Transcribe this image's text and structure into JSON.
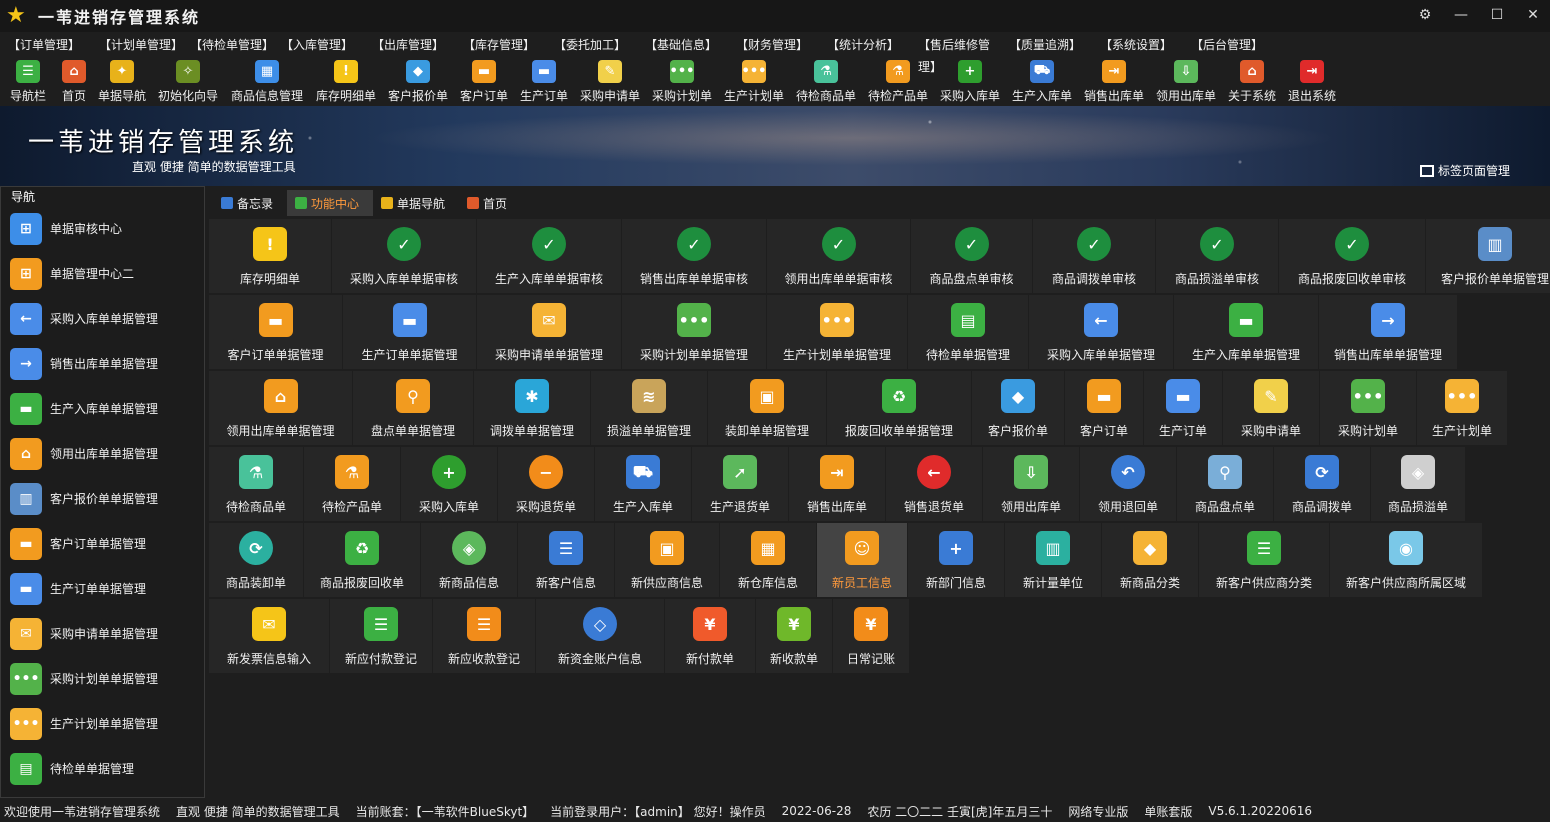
{
  "window": {
    "title": "一苇进销存管理系统"
  },
  "menu": [
    "【订单管理】",
    "【计划单管理】",
    "【待检单管理】",
    "【入库管理】",
    "【出库管理】",
    "【库存管理】",
    "【委托加工】",
    "【基础信息】",
    "【财务管理】",
    "【统计分析】",
    "【售后维修管理】",
    "【质量追溯】",
    "【系统设置】",
    "【后台管理】"
  ],
  "toolbar": [
    {
      "label": "导航栏",
      "icon": "menu-icon",
      "color": "#3cb043",
      "glyph": "☰",
      "w": 56
    },
    {
      "label": "首页",
      "icon": "home-icon",
      "color": "#e05a2b",
      "glyph": "⌂",
      "w": 36
    },
    {
      "label": "单据导航",
      "icon": "wand-icon",
      "color": "#e8b21a",
      "glyph": "✦",
      "w": 60
    },
    {
      "label": "初始化向导",
      "icon": "magic-icon",
      "color": "#6b8e23",
      "glyph": "✧",
      "w": 72
    },
    {
      "label": "商品信息管理",
      "icon": "cubes-icon",
      "color": "#3d8ee8",
      "glyph": "▦",
      "w": 86
    },
    {
      "label": "库存明细单",
      "icon": "warning-icon",
      "color": "#f5c518",
      "glyph": "!",
      "w": 72
    },
    {
      "label": "客户报价单",
      "icon": "tag-icon",
      "color": "#3a9be0",
      "glyph": "◆",
      "w": 72
    },
    {
      "label": "客户订单",
      "icon": "order-icon",
      "color": "#f29b1f",
      "glyph": "▬",
      "w": 60
    },
    {
      "label": "生产订单",
      "icon": "production-order-icon",
      "color": "#4a8ce8",
      "glyph": "▬",
      "w": 60
    },
    {
      "label": "采购申请单",
      "icon": "request-icon",
      "color": "#f1d04a",
      "glyph": "✎",
      "w": 72
    },
    {
      "label": "采购计划单",
      "icon": "chat-green-icon",
      "color": "#53b24a",
      "glyph": "•••",
      "w": 72
    },
    {
      "label": "生产计划单",
      "icon": "chat-orange-icon",
      "color": "#f5b335",
      "glyph": "•••",
      "w": 72
    },
    {
      "label": "待检商品单",
      "icon": "flask-green-icon",
      "color": "#49c29a",
      "glyph": "⚗",
      "w": 72
    },
    {
      "label": "待检产品单",
      "icon": "flask-orange-icon",
      "color": "#f29b1f",
      "glyph": "⚗",
      "w": 72
    },
    {
      "label": "采购入库单",
      "icon": "plus-icon",
      "color": "#2e9e2e",
      "glyph": "+",
      "w": 72
    },
    {
      "label": "生产入库单",
      "icon": "cart-icon",
      "color": "#3a7bd5",
      "glyph": "⛟",
      "w": 72
    },
    {
      "label": "销售出库单",
      "icon": "export-icon",
      "color": "#f29b1f",
      "glyph": "⇥",
      "w": 72
    },
    {
      "label": "领用出库单",
      "icon": "download-icon",
      "color": "#5cb85c",
      "glyph": "⇩",
      "w": 72
    },
    {
      "label": "关于系统",
      "icon": "about-icon",
      "color": "#e05a2b",
      "glyph": "⌂",
      "w": 60
    },
    {
      "label": "退出系统",
      "icon": "exit-icon",
      "color": "#e02b2b",
      "glyph": "⇥",
      "w": 60
    }
  ],
  "banner": {
    "title": "一苇进销存管理系统",
    "subtitle": "直观 便捷 简单的数据管理工具",
    "tab_manage": "标签页面管理"
  },
  "sidebar": {
    "title": "导航",
    "items": [
      {
        "label": "单据审核中心",
        "icon": "grid-blue-icon",
        "color": "#3d8ee8",
        "glyph": "⊞"
      },
      {
        "label": "单据管理中心二",
        "icon": "grid-orange-icon",
        "color": "#f29b1f",
        "glyph": "⊞"
      },
      {
        "label": "采购入库单单据管理",
        "icon": "arrow-left-icon",
        "color": "#4a8ce8",
        "glyph": "←"
      },
      {
        "label": "销售出库单单据管理",
        "icon": "arrow-right-icon",
        "color": "#4a8ce8",
        "glyph": "→"
      },
      {
        "label": "生产入库单单据管理",
        "icon": "box-green-icon",
        "color": "#3cb043",
        "glyph": "▬"
      },
      {
        "label": "领用出库单单据管理",
        "icon": "box-orange-icon",
        "color": "#f29b1f",
        "glyph": "⌂"
      },
      {
        "label": "客户报价单单据管理",
        "icon": "books-icon",
        "color": "#5a8dc8",
        "glyph": "▥"
      },
      {
        "label": "客户订单单据管理",
        "icon": "order-icon",
        "color": "#f29b1f",
        "glyph": "▬"
      },
      {
        "label": "生产订单单据管理",
        "icon": "production-order-icon",
        "color": "#4a8ce8",
        "glyph": "▬"
      },
      {
        "label": "采购申请单单据管理",
        "icon": "envelope-icon",
        "color": "#f5b335",
        "glyph": "✉"
      },
      {
        "label": "采购计划单单据管理",
        "icon": "chat-green-icon",
        "color": "#53b24a",
        "glyph": "•••"
      },
      {
        "label": "生产计划单单据管理",
        "icon": "chat-orange-icon",
        "color": "#f5b335",
        "glyph": "•••"
      },
      {
        "label": "待检单单据管理",
        "icon": "doc-green-icon",
        "color": "#3cb043",
        "glyph": "▤"
      }
    ]
  },
  "tabs": [
    {
      "label": "备忘录",
      "icon": "memo-icon",
      "color": "#3a7bd5"
    },
    {
      "label": "功能中心",
      "icon": "function-icon",
      "color": "#3cb043",
      "active": true
    },
    {
      "label": "单据导航",
      "icon": "wand-icon",
      "color": "#e8b21a"
    },
    {
      "label": "首页",
      "icon": "home-icon",
      "color": "#e05a2b"
    }
  ],
  "grid": [
    [
      {
        "label": "库存明细单",
        "icon": "warning-icon",
        "color": "#f5c518",
        "glyph": "!",
        "w": 122
      },
      {
        "label": "采购入库单单据审核",
        "icon": "check-icon",
        "color": "#1e8e3e",
        "glyph": "✓",
        "round": true,
        "w": 144
      },
      {
        "label": "生产入库单单据审核",
        "icon": "check-icon",
        "color": "#1e8e3e",
        "glyph": "✓",
        "round": true,
        "w": 144
      },
      {
        "label": "销售出库单单据审核",
        "icon": "check-icon",
        "color": "#1e8e3e",
        "glyph": "✓",
        "round": true,
        "w": 144
      },
      {
        "label": "领用出库单单据审核",
        "icon": "check-icon",
        "color": "#1e8e3e",
        "glyph": "✓",
        "round": true,
        "w": 143
      },
      {
        "label": "商品盘点单审核",
        "icon": "check-icon",
        "color": "#1e8e3e",
        "glyph": "✓",
        "round": true,
        "w": 121
      },
      {
        "label": "商品调拨单审核",
        "icon": "check-icon",
        "color": "#1e8e3e",
        "glyph": "✓",
        "round": true,
        "w": 122
      },
      {
        "label": "商品损溢单审核",
        "icon": "check-icon",
        "color": "#1e8e3e",
        "glyph": "✓",
        "round": true,
        "w": 122
      },
      {
        "label": "商品报废回收单审核",
        "icon": "check-icon",
        "color": "#1e8e3e",
        "glyph": "✓",
        "round": true,
        "w": 146
      },
      {
        "label": "客户报价单单据管理",
        "icon": "books-icon",
        "color": "#5a8dc8",
        "glyph": "▥",
        "w": 138
      }
    ],
    [
      {
        "label": "客户订单单据管理",
        "icon": "order-icon",
        "color": "#f29b1f",
        "glyph": "▬",
        "w": 133
      },
      {
        "label": "生产订单单据管理",
        "icon": "production-order-icon",
        "color": "#4a8ce8",
        "glyph": "▬",
        "w": 133
      },
      {
        "label": "采购申请单单据管理",
        "icon": "envelope-icon",
        "color": "#f5b335",
        "glyph": "✉",
        "w": 144
      },
      {
        "label": "采购计划单单据管理",
        "icon": "chat-green-icon",
        "color": "#53b24a",
        "glyph": "•••",
        "w": 144
      },
      {
        "label": "生产计划单单据管理",
        "icon": "chat-orange-icon",
        "color": "#f5b335",
        "glyph": "•••",
        "w": 140
      },
      {
        "label": "待检单单据管理",
        "icon": "doc-green-icon",
        "color": "#3cb043",
        "glyph": "▤",
        "w": 120
      },
      {
        "label": "采购入库单单据管理",
        "icon": "arrow-left-icon",
        "color": "#4a8ce8",
        "glyph": "←",
        "w": 144
      },
      {
        "label": "生产入库单单据管理",
        "icon": "box-green-icon",
        "color": "#3cb043",
        "glyph": "▬",
        "w": 144
      },
      {
        "label": "销售出库单单据管理",
        "icon": "arrow-right-icon",
        "color": "#4a8ce8",
        "glyph": "→",
        "w": 138
      }
    ],
    [
      {
        "label": "领用出库单单据管理",
        "icon": "box-orange-icon",
        "color": "#f29b1f",
        "glyph": "⌂",
        "w": 143
      },
      {
        "label": "盘点单单据管理",
        "icon": "search-person-icon",
        "color": "#f29b1f",
        "glyph": "⚲",
        "w": 120
      },
      {
        "label": "调拨单单据管理",
        "icon": "network-icon",
        "color": "#2aa6d8",
        "glyph": "✱",
        "w": 116
      },
      {
        "label": "损溢单单据管理",
        "icon": "layers-plus-icon",
        "color": "#c9a45a",
        "glyph": "≋",
        "w": 116
      },
      {
        "label": "装卸单单据管理",
        "icon": "package-icon",
        "color": "#f29b1f",
        "glyph": "▣",
        "w": 118
      },
      {
        "label": "报废回收单单据管理",
        "icon": "recycle-icon",
        "color": "#3cb043",
        "glyph": "♻",
        "w": 144
      },
      {
        "label": "客户报价单",
        "icon": "tag-icon",
        "color": "#3a9be0",
        "glyph": "◆",
        "w": 92
      },
      {
        "label": "客户订单",
        "icon": "order-icon",
        "color": "#f29b1f",
        "glyph": "▬",
        "w": 78
      },
      {
        "label": "生产订单",
        "icon": "production-order-icon",
        "color": "#4a8ce8",
        "glyph": "▬",
        "w": 78
      },
      {
        "label": "采购申请单",
        "icon": "request-icon",
        "color": "#f1d04a",
        "glyph": "✎",
        "w": 96
      },
      {
        "label": "采购计划单",
        "icon": "chat-green-icon",
        "color": "#53b24a",
        "glyph": "•••",
        "w": 96
      },
      {
        "label": "生产计划单",
        "icon": "chat-orange-icon",
        "color": "#f5b335",
        "glyph": "•••",
        "w": 90
      }
    ],
    [
      {
        "label": "待检商品单",
        "icon": "flask-green-icon",
        "color": "#49c29a",
        "glyph": "⚗",
        "w": 94
      },
      {
        "label": "待检产品单",
        "icon": "flask-orange-icon",
        "color": "#f29b1f",
        "glyph": "⚗",
        "w": 96
      },
      {
        "label": "采购入库单",
        "icon": "plus-icon",
        "color": "#2e9e2e",
        "glyph": "+",
        "round": true,
        "w": 96
      },
      {
        "label": "采购退货单",
        "icon": "minus-icon",
        "color": "#f28c1a",
        "glyph": "−",
        "round": true,
        "w": 96
      },
      {
        "label": "生产入库单",
        "icon": "cart-icon",
        "color": "#3a7bd5",
        "glyph": "⛟",
        "w": 96
      },
      {
        "label": "生产退货单",
        "icon": "arrow-up-right-icon",
        "color": "#5cb85c",
        "glyph": "➚",
        "w": 96
      },
      {
        "label": "销售出库单",
        "icon": "export-icon",
        "color": "#f29b1f",
        "glyph": "⇥",
        "w": 96
      },
      {
        "label": "销售退货单",
        "icon": "arrow-left-red-icon",
        "color": "#e02b2b",
        "glyph": "←",
        "round": true,
        "w": 96
      },
      {
        "label": "领用出库单",
        "icon": "download-icon",
        "color": "#5cb85c",
        "glyph": "⇩",
        "w": 96
      },
      {
        "label": "领用退回单",
        "icon": "undo-icon",
        "color": "#3a7bd5",
        "glyph": "↶",
        "round": true,
        "w": 96
      },
      {
        "label": "商品盘点单",
        "icon": "map-search-icon",
        "color": "#7aaed8",
        "glyph": "⚲",
        "w": 96
      },
      {
        "label": "商品调拨单",
        "icon": "sync-icon",
        "color": "#3a7bd5",
        "glyph": "⟳",
        "w": 96
      },
      {
        "label": "商品损溢单",
        "icon": "tag-plus-icon",
        "color": "#cfcfcf",
        "glyph": "◈",
        "w": 94
      }
    ],
    [
      {
        "label": "商品装卸单",
        "icon": "refresh-icon",
        "color": "#2bb0a0",
        "glyph": "⟳",
        "round": true,
        "w": 94
      },
      {
        "label": "商品报废回收单",
        "icon": "trash-recycle-icon",
        "color": "#3cb043",
        "glyph": "♻",
        "w": 116
      },
      {
        "label": "新商品信息",
        "icon": "cube-green-icon",
        "color": "#5cb85c",
        "glyph": "◈",
        "round": true,
        "w": 96
      },
      {
        "label": "新客户信息",
        "icon": "user-list-icon",
        "color": "#3a7bd5",
        "glyph": "☰",
        "w": 96
      },
      {
        "label": "新供应商信息",
        "icon": "supplier-card-icon",
        "color": "#f29b1f",
        "glyph": "▣",
        "w": 104
      },
      {
        "label": "新仓库信息",
        "icon": "warehouse-boxes-icon",
        "color": "#f29b1f",
        "glyph": "▦",
        "w": 96
      },
      {
        "label": "新员工信息",
        "icon": "staff-icon",
        "color": "#f29b1f",
        "glyph": "☺",
        "w": 90,
        "selected": true
      },
      {
        "label": "新部门信息",
        "icon": "user-add-icon",
        "color": "#3a7bd5",
        "glyph": "+",
        "w": 96
      },
      {
        "label": "新计量单位",
        "icon": "ruler-icon",
        "color": "#2bb0a0",
        "glyph": "▥",
        "w": 96
      },
      {
        "label": "新商品分类",
        "icon": "price-tag-icon",
        "color": "#f5b335",
        "glyph": "◆",
        "w": 96
      },
      {
        "label": "新客户供应商分类",
        "icon": "tree-list-icon",
        "color": "#3cb043",
        "glyph": "☰",
        "w": 130
      },
      {
        "label": "新客户供应商所属区域",
        "icon": "map-pin-icon",
        "color": "#7ac8e8",
        "glyph": "◉",
        "w": 152
      }
    ],
    [
      {
        "label": "新发票信息输入",
        "icon": "invoice-envelope-icon",
        "color": "#f5c518",
        "glyph": "✉",
        "w": 120
      },
      {
        "label": "新应付款登记",
        "icon": "payable-list-icon",
        "color": "#3cb043",
        "glyph": "☰",
        "w": 102
      },
      {
        "label": "新应收款登记",
        "icon": "receivable-list-icon",
        "color": "#f28c1a",
        "glyph": "☰",
        "w": 102
      },
      {
        "label": "新资金账户信息",
        "icon": "account-diamond-icon",
        "color": "#3a7bd5",
        "glyph": "◇",
        "round": true,
        "w": 128
      },
      {
        "label": "新付款单",
        "icon": "payment-icon",
        "color": "#f05a2b",
        "glyph": "¥",
        "w": 90
      },
      {
        "label": "新收款单",
        "icon": "receipt-icon",
        "color": "#6fb82a",
        "glyph": "¥",
        "w": 76
      },
      {
        "label": "日常记账",
        "icon": "bookkeeping-icon",
        "color": "#f28c1a",
        "glyph": "¥",
        "w": 76
      }
    ]
  ],
  "status": {
    "welcome": "欢迎使用一苇进销存管理系统",
    "slogan": "直观 便捷 简单的数据管理工具",
    "account": "当前账套：【一苇软件BlueSkyt】",
    "user": "当前登录用户：【admin】 您好！操作员",
    "date": "2022-06-28",
    "lunar": "农历 二〇二二 壬寅[虎]年五月三十",
    "edition": "网络专业版",
    "mode": "单账套版",
    "version": "V5.6.1.20220616"
  }
}
